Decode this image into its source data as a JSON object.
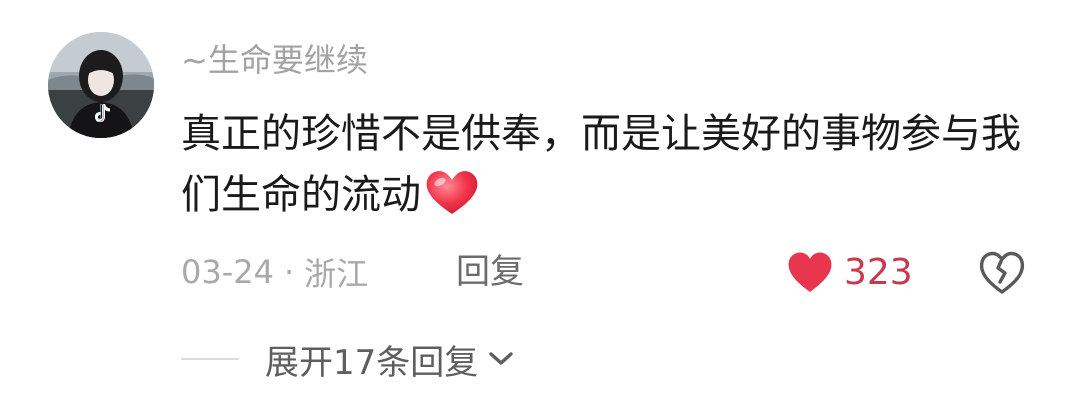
{
  "comment": {
    "username": "~生命要继续",
    "text": "真正的珍惜不是供奉，而是让美好的事物参与我们生命的流动",
    "emoji": "heart-emoji",
    "date": "03-24",
    "separator": "·",
    "location": "浙江",
    "reply_label": "回复",
    "like_count": "323",
    "liked": true,
    "expand_label": "展开17条回复"
  },
  "colors": {
    "like_red": "#e8364f",
    "like_count": "#c8384e",
    "username": "#a3a3a3",
    "body_text": "#1a1a1a",
    "meta_text": "#a9a9a9"
  }
}
